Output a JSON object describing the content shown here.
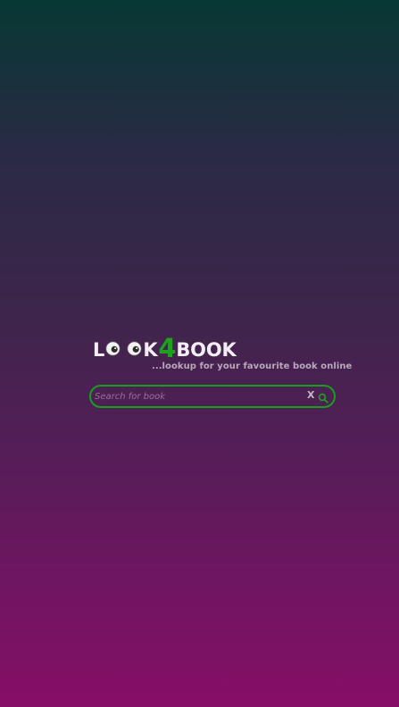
{
  "brand": {
    "logo": {
      "part_l": "L",
      "part_k": "K",
      "part_4": "4",
      "part_book": "BOOK",
      "eyes_icon": "googly-eyes-icon",
      "accent_color": "#1fa11f"
    },
    "tagline": "...lookup for your favourite book online"
  },
  "search": {
    "placeholder": "Search for book",
    "value": "",
    "clear_label": "X",
    "search_icon": "magnifier-icon",
    "border_color": "#169f1c"
  }
}
